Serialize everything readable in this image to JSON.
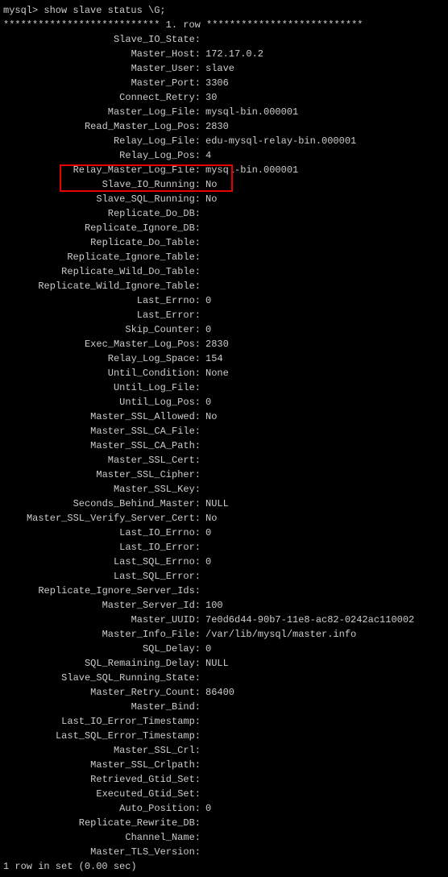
{
  "prompt": "mysql> show slave status \\G;",
  "header": "*************************** 1. row ***************************",
  "rows": [
    {
      "label": "Slave_IO_State:",
      "value": ""
    },
    {
      "label": "Master_Host:",
      "value": "172.17.0.2"
    },
    {
      "label": "Master_User:",
      "value": "slave"
    },
    {
      "label": "Master_Port:",
      "value": "3306"
    },
    {
      "label": "Connect_Retry:",
      "value": "30"
    },
    {
      "label": "Master_Log_File:",
      "value": "mysql-bin.000001"
    },
    {
      "label": "Read_Master_Log_Pos:",
      "value": "2830"
    },
    {
      "label": "Relay_Log_File:",
      "value": "edu-mysql-relay-bin.000001"
    },
    {
      "label": "Relay_Log_Pos:",
      "value": "4"
    },
    {
      "label": "Relay_Master_Log_File:",
      "value": "mysql-bin.000001"
    },
    {
      "label": "Slave_IO_Running:",
      "value": "No"
    },
    {
      "label": "Slave_SQL_Running:",
      "value": "No"
    },
    {
      "label": "Replicate_Do_DB:",
      "value": ""
    },
    {
      "label": "Replicate_Ignore_DB:",
      "value": ""
    },
    {
      "label": "Replicate_Do_Table:",
      "value": ""
    },
    {
      "label": "Replicate_Ignore_Table:",
      "value": ""
    },
    {
      "label": "Replicate_Wild_Do_Table:",
      "value": ""
    },
    {
      "label": "Replicate_Wild_Ignore_Table:",
      "value": ""
    },
    {
      "label": "Last_Errno:",
      "value": "0"
    },
    {
      "label": "Last_Error:",
      "value": ""
    },
    {
      "label": "Skip_Counter:",
      "value": "0"
    },
    {
      "label": "Exec_Master_Log_Pos:",
      "value": "2830"
    },
    {
      "label": "Relay_Log_Space:",
      "value": "154"
    },
    {
      "label": "Until_Condition:",
      "value": "None"
    },
    {
      "label": "Until_Log_File:",
      "value": ""
    },
    {
      "label": "Until_Log_Pos:",
      "value": "0"
    },
    {
      "label": "Master_SSL_Allowed:",
      "value": "No"
    },
    {
      "label": "Master_SSL_CA_File:",
      "value": ""
    },
    {
      "label": "Master_SSL_CA_Path:",
      "value": ""
    },
    {
      "label": "Master_SSL_Cert:",
      "value": ""
    },
    {
      "label": "Master_SSL_Cipher:",
      "value": ""
    },
    {
      "label": "Master_SSL_Key:",
      "value": ""
    },
    {
      "label": "Seconds_Behind_Master:",
      "value": "NULL"
    },
    {
      "label": "Master_SSL_Verify_Server_Cert:",
      "value": "No"
    },
    {
      "label": "Last_IO_Errno:",
      "value": "0"
    },
    {
      "label": "Last_IO_Error:",
      "value": ""
    },
    {
      "label": "Last_SQL_Errno:",
      "value": "0"
    },
    {
      "label": "Last_SQL_Error:",
      "value": ""
    },
    {
      "label": "Replicate_Ignore_Server_Ids:",
      "value": ""
    },
    {
      "label": "Master_Server_Id:",
      "value": "100"
    },
    {
      "label": "Master_UUID:",
      "value": "7e0d6d44-90b7-11e8-ac82-0242ac110002"
    },
    {
      "label": "Master_Info_File:",
      "value": "/var/lib/mysql/master.info"
    },
    {
      "label": "SQL_Delay:",
      "value": "0"
    },
    {
      "label": "SQL_Remaining_Delay:",
      "value": "NULL"
    },
    {
      "label": "Slave_SQL_Running_State:",
      "value": ""
    },
    {
      "label": "Master_Retry_Count:",
      "value": "86400"
    },
    {
      "label": "Master_Bind:",
      "value": ""
    },
    {
      "label": "Last_IO_Error_Timestamp:",
      "value": ""
    },
    {
      "label": "Last_SQL_Error_Timestamp:",
      "value": ""
    },
    {
      "label": "Master_SSL_Crl:",
      "value": ""
    },
    {
      "label": "Master_SSL_Crlpath:",
      "value": ""
    },
    {
      "label": "Retrieved_Gtid_Set:",
      "value": ""
    },
    {
      "label": "Executed_Gtid_Set:",
      "value": ""
    },
    {
      "label": "Auto_Position:",
      "value": "0"
    },
    {
      "label": "Replicate_Rewrite_DB:",
      "value": ""
    },
    {
      "label": "Channel_Name:",
      "value": ""
    },
    {
      "label": "Master_TLS_Version:",
      "value": ""
    }
  ],
  "footer": "1 row in set (0.00 sec)"
}
